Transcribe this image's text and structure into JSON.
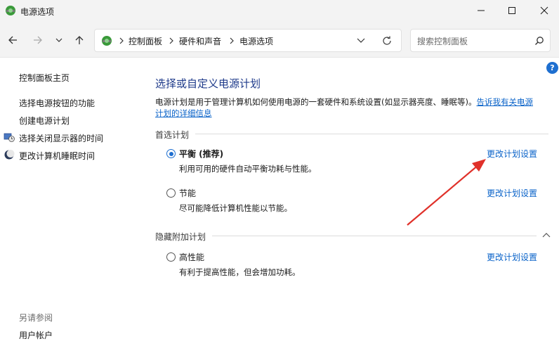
{
  "window": {
    "title": "电源选项"
  },
  "address": {
    "crumbs": [
      "控制面板",
      "硬件和声音",
      "电源选项"
    ]
  },
  "search": {
    "placeholder": "搜索控制面板"
  },
  "sidebar": {
    "home": "控制面板主页",
    "items": [
      "选择电源按钮的功能",
      "创建电源计划",
      "选择关闭显示器的时间",
      "更改计算机睡眠时间"
    ],
    "see_also_header": "另请参阅",
    "see_also_items": [
      "用户帐户"
    ]
  },
  "main": {
    "title": "选择或自定义电源计划",
    "description": "电源计划是用于管理计算机如何使用电源的一套硬件和系统设置(如显示器亮度、睡眠等)。",
    "description_link_part1": "告诉我有关电源",
    "description_link_part2": "计划的详细信息",
    "preferred_header": "首选计划",
    "hidden_header": "隐藏附加计划",
    "change_link": "更改计划设置",
    "plans": [
      {
        "name": "平衡 (推荐)",
        "desc": "利用可用的硬件自动平衡功耗与性能。",
        "selected": true
      },
      {
        "name": "节能",
        "desc": "尽可能降低计算机性能以节能。",
        "selected": false
      }
    ],
    "hidden_plans": [
      {
        "name": "高性能",
        "desc": "有利于提高性能，但会增加功耗。",
        "selected": false
      }
    ]
  },
  "colors": {
    "accent": "#1e6fd0",
    "title_blue": "#1e3a8a",
    "link_blue": "#0a63c9",
    "annotation_red": "#e0312a"
  }
}
